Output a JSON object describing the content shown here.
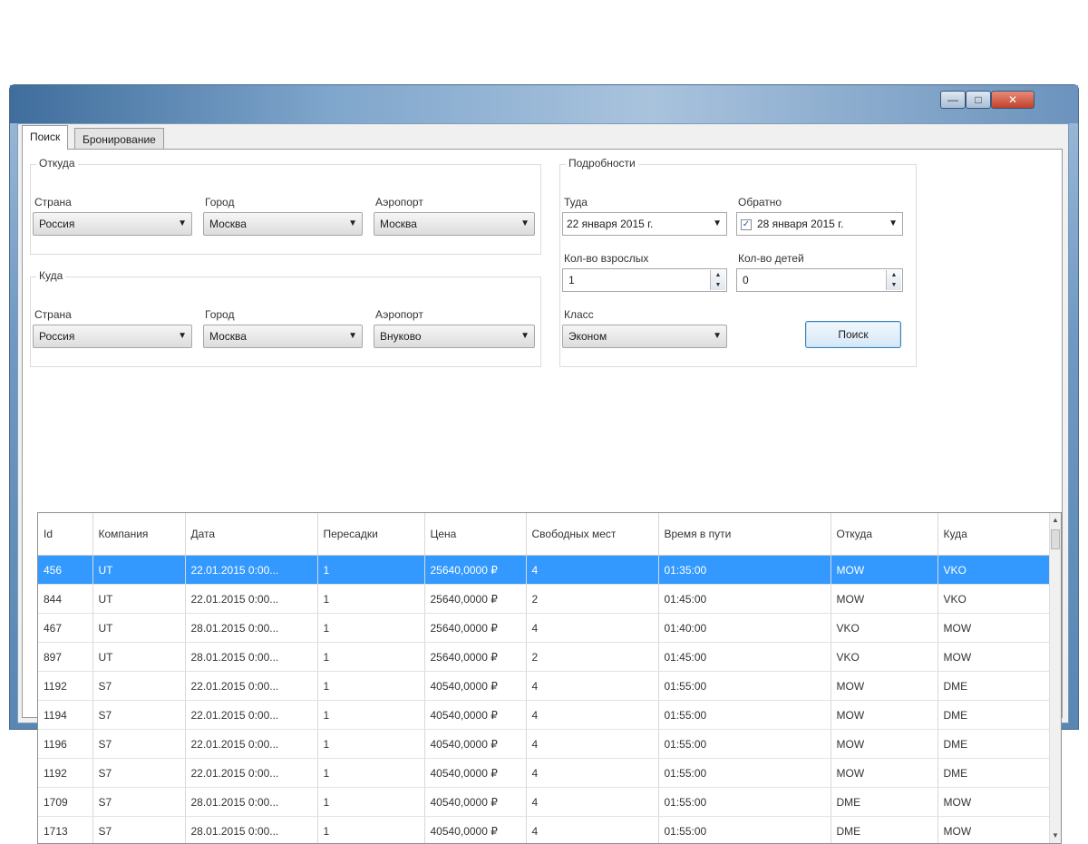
{
  "window": {
    "min_label": "—",
    "max_label": "□",
    "close_label": "✕"
  },
  "tabs": [
    {
      "label": "Поиск"
    },
    {
      "label": "Бронирование"
    }
  ],
  "from_group": {
    "title": "Откуда",
    "country_label": "Страна",
    "country_value": "Россия",
    "city_label": "Город",
    "city_value": "Москва",
    "airport_label": "Аэропорт",
    "airport_value": "Москва"
  },
  "to_group": {
    "title": "Куда",
    "country_label": "Страна",
    "country_value": "Россия",
    "city_label": "Город",
    "city_value": "Москва",
    "airport_label": "Аэропорт",
    "airport_value": "Внуково"
  },
  "details_group": {
    "title": "Подробности",
    "there_label": "Туда",
    "there_date": "22 января 2015 г.",
    "back_label": "Обратно",
    "back_date": "28 января 2015 г.",
    "back_checked": true,
    "adults_label": "Кол-во взрослых",
    "adults_value": "1",
    "children_label": "Кол-во детей",
    "children_value": "0",
    "class_label": "Класс",
    "class_value": "Эконом",
    "search_button": "Поиск"
  },
  "results": {
    "columns": [
      "Id",
      "Компания",
      "Дата",
      "Пересадки",
      "Цена",
      "Свободных мест",
      "Время в пути",
      "Откуда",
      "Куда"
    ],
    "rows": [
      [
        "456",
        "UT",
        "22.01.2015 0:00...",
        "1",
        "25640,0000 ₽",
        "4",
        "01:35:00",
        "MOW",
        "VKO"
      ],
      [
        "844",
        "UT",
        "22.01.2015 0:00...",
        "1",
        "25640,0000 ₽",
        "2",
        "01:45:00",
        "MOW",
        "VKO"
      ],
      [
        "467",
        "UT",
        "28.01.2015 0:00...",
        "1",
        "25640,0000 ₽",
        "4",
        "01:40:00",
        "VKO",
        "MOW"
      ],
      [
        "897",
        "UT",
        "28.01.2015 0:00...",
        "1",
        "25640,0000 ₽",
        "2",
        "01:45:00",
        "VKO",
        "MOW"
      ],
      [
        "1192",
        "S7",
        "22.01.2015 0:00...",
        "1",
        "40540,0000 ₽",
        "4",
        "01:55:00",
        "MOW",
        "DME"
      ],
      [
        "1194",
        "S7",
        "22.01.2015 0:00...",
        "1",
        "40540,0000 ₽",
        "4",
        "01:55:00",
        "MOW",
        "DME"
      ],
      [
        "1196",
        "S7",
        "22.01.2015 0:00...",
        "1",
        "40540,0000 ₽",
        "4",
        "01:55:00",
        "MOW",
        "DME"
      ],
      [
        "1192",
        "S7",
        "22.01.2015 0:00...",
        "1",
        "40540,0000 ₽",
        "4",
        "01:55:00",
        "MOW",
        "DME"
      ],
      [
        "1709",
        "S7",
        "28.01.2015 0:00...",
        "1",
        "40540,0000 ₽",
        "4",
        "01:55:00",
        "DME",
        "MOW"
      ],
      [
        "1713",
        "S7",
        "28.01.2015 0:00...",
        "1",
        "40540,0000 ₽",
        "4",
        "01:55:00",
        "DME",
        "MOW"
      ]
    ],
    "selected_row": 0
  },
  "colors": {
    "selection": "#3399ff",
    "button_border": "#3c7fb1",
    "close_button": "#c2412a"
  }
}
